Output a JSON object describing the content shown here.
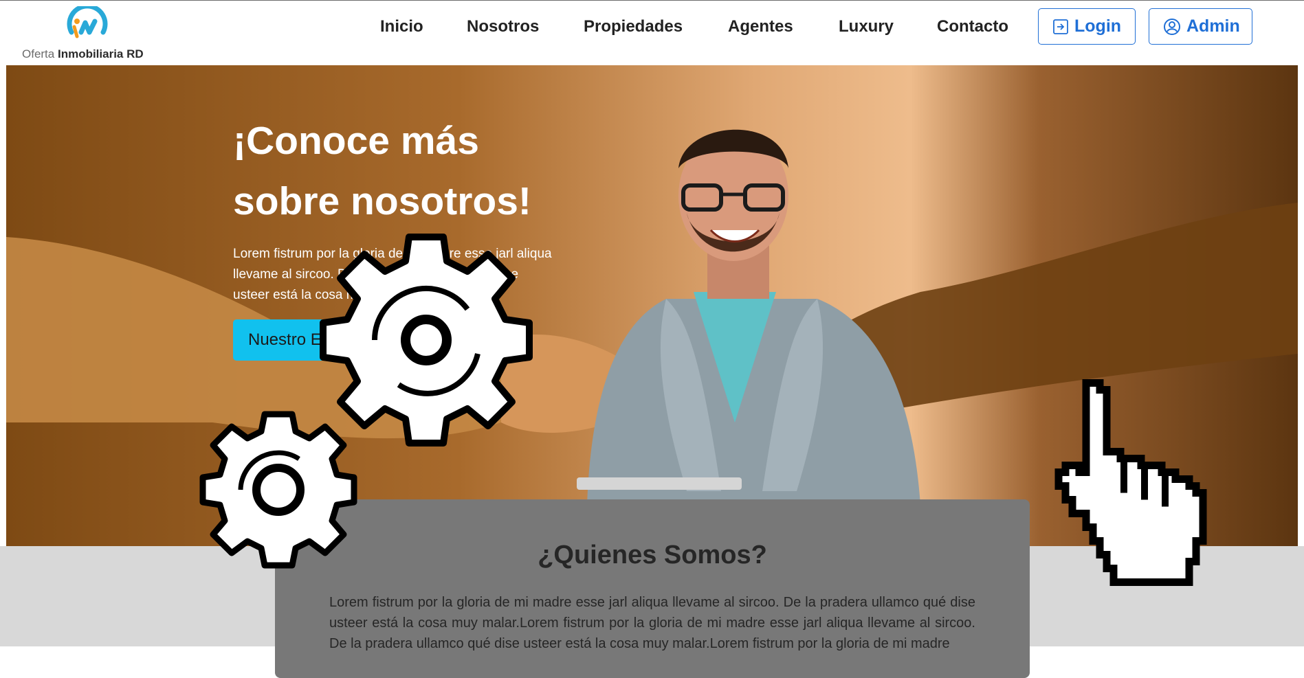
{
  "logo": {
    "text_regular": "Oferta ",
    "text_bold": "Inmobiliaria RD"
  },
  "nav": {
    "items": [
      "Inicio",
      "Nosotros",
      "Propiedades",
      "Agentes",
      "Luxury",
      "Contacto"
    ],
    "login_label": "Login",
    "admin_label": "Admin"
  },
  "hero": {
    "title_line1": "¡Conoce más",
    "title_line2": "sobre nosotros!",
    "text": "Lorem fistrum por la gloria de mi madre esse jarl aliqua llevame al sircoo. De la pradera ullamco qué dise usteer está la cosa muy malar.",
    "button_label": "Nuestro Equipo"
  },
  "about": {
    "title": "¿Quienes Somos?",
    "text": "Lorem fistrum por la gloria de mi madre esse jarl aliqua llevame al sircoo. De la pradera ullamco qué dise usteer está la cosa muy malar.Lorem fistrum por la gloria de mi madre esse jarl aliqua llevame al sircoo. De la pradera ullamco qué dise usteer está la cosa muy malar.Lorem fistrum por la gloria de mi madre"
  },
  "colors": {
    "accent": "#1f6fd6",
    "hero_button": "#11c1ee",
    "card": "#787878"
  },
  "icons": [
    "login-icon",
    "user-circle-icon",
    "gear-icon",
    "pointer-hand-icon"
  ]
}
